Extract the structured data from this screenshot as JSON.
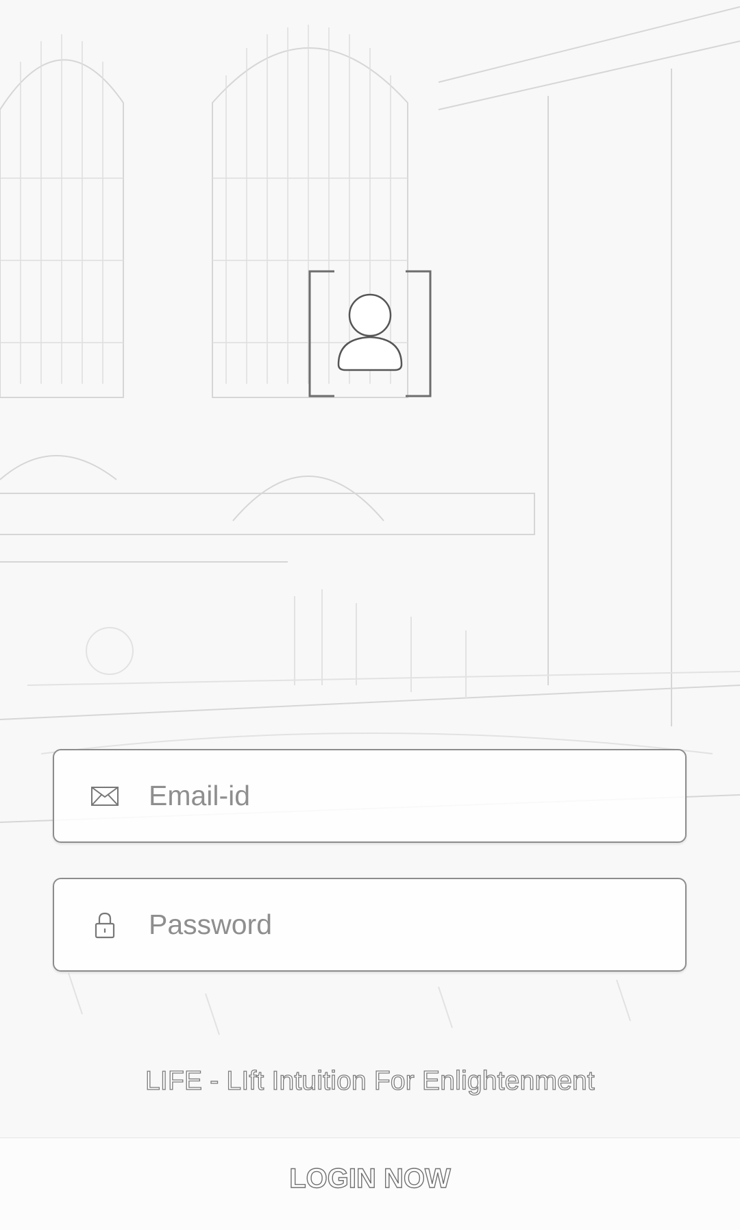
{
  "form": {
    "email": {
      "placeholder": "Email-id",
      "icon": "envelope-icon"
    },
    "password": {
      "placeholder": "Password",
      "icon": "lock-icon"
    }
  },
  "logo": {
    "icon": "user-bracket-icon"
  },
  "tagline": "LIFE - LIft Intuition For Enlightenment",
  "login_button": {
    "label": "LOGIN NOW"
  },
  "colors": {
    "background": "#f7f7f7",
    "field_border": "#8c8c8c",
    "text_outline": "#707070"
  }
}
